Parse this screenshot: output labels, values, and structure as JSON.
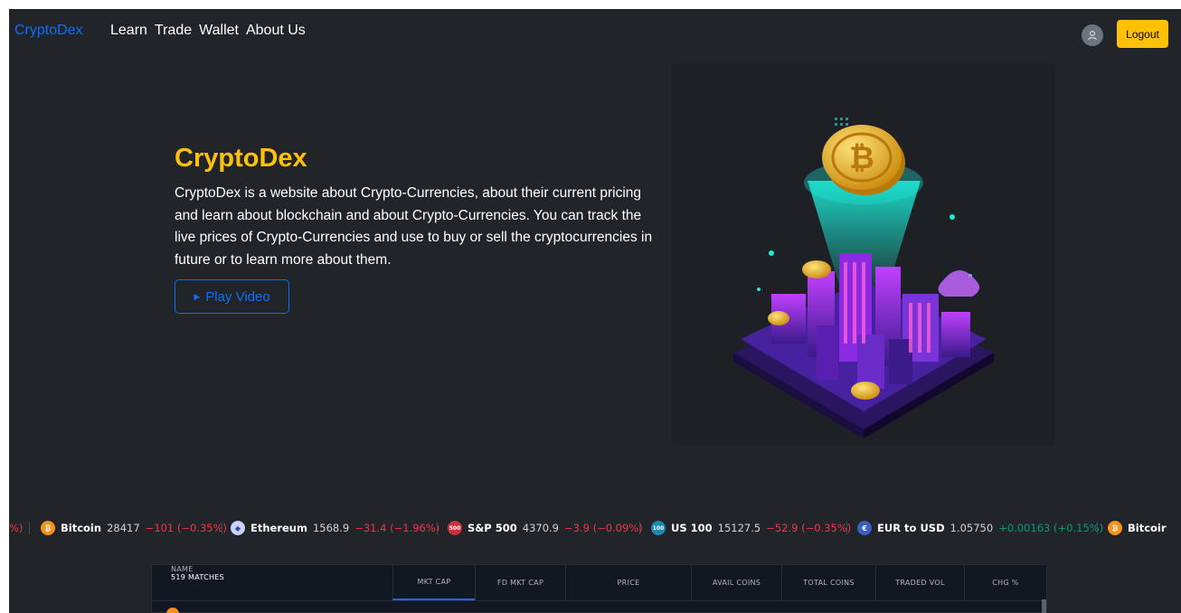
{
  "nav": {
    "brand": "CryptoDex",
    "links": [
      "Learn",
      "Trade",
      "Wallet",
      "About Us"
    ],
    "avatar_icon": "user-icon",
    "logout_label": "Logout"
  },
  "hero": {
    "title": "CryptoDex",
    "description": "CryptoDex is a website about Crypto-Currencies, about their current pricing and learn about blockchain and about Crypto-Currencies. You can track the live prices of Crypto-Currencies and use to buy or sell the cryptocurrencies in future or to learn more about them.",
    "play_label": "Play Video",
    "play_icon": "play-icon",
    "image_alt_icon": "crypto-city-illustration"
  },
  "ticker": {
    "leading_fragment": "%)",
    "items": [
      {
        "icon": "bitcoin-icon",
        "icon_text": "₿",
        "icon_color": "#f7931a",
        "name": "Bitcoin",
        "price": "28417",
        "change": "−101 (−0.35%)",
        "direction": "down"
      },
      {
        "icon": "ethereum-icon",
        "icon_text": "◆",
        "icon_color": "#c7d2fe",
        "name": "Ethereum",
        "price": "1568.9",
        "change": "−31.4 (−1.96%)",
        "direction": "down"
      },
      {
        "icon": "sp500-icon",
        "icon_text": "500",
        "icon_color": "#cc2f3c",
        "name": "S&P 500",
        "price": "4370.9",
        "change": "−3.9 (−0.09%)",
        "direction": "down"
      },
      {
        "icon": "us100-icon",
        "icon_text": "100",
        "icon_color": "#1e88b4",
        "name": "US 100",
        "price": "15127.5",
        "change": "−52.9 (−0.35%)",
        "direction": "down"
      },
      {
        "icon": "eur-usd-icon",
        "icon_text": "€",
        "icon_color": "#3a5ec2",
        "name": "EUR to USD",
        "price": "1.05750",
        "change": "+0.00163 (+0.15%)",
        "direction": "up"
      },
      {
        "icon": "bitcoin-icon",
        "icon_text": "₿",
        "icon_color": "#f7931a",
        "name": "Bitcoir",
        "price": "",
        "change": "",
        "direction": "down"
      }
    ]
  },
  "table": {
    "columns": [
      {
        "label": "Name",
        "sub": "519 matches"
      },
      {
        "label": "Mkt Cap",
        "sub": ""
      },
      {
        "label": "FD Mkt Cap",
        "sub": ""
      },
      {
        "label": "Price",
        "sub": ""
      },
      {
        "label": "Avail Coins",
        "sub": ""
      },
      {
        "label": "Total Coins",
        "sub": ""
      },
      {
        "label": "Traded Vol",
        "sub": ""
      },
      {
        "label": "Chg %",
        "sub": ""
      }
    ],
    "active_column": "Mkt Cap"
  }
}
